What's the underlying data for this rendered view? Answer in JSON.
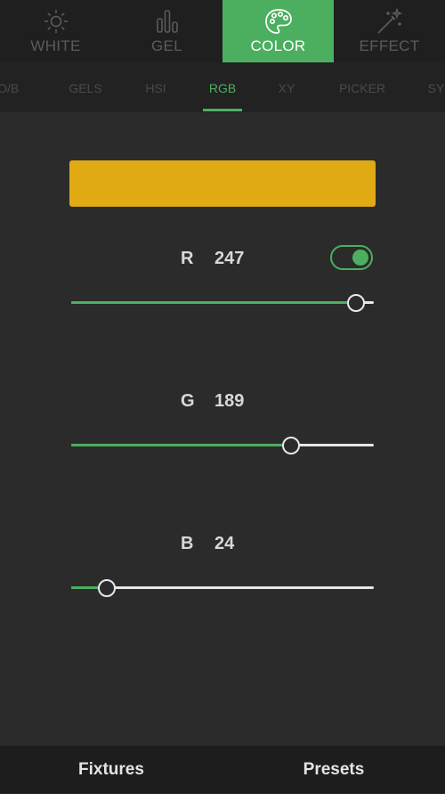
{
  "mode_tabs": [
    {
      "label": "WHITE",
      "icon": "sun-icon"
    },
    {
      "label": "GEL",
      "icon": "bar-chart-icon"
    },
    {
      "label": "COLOR",
      "icon": "palette-icon",
      "active": true
    },
    {
      "label": "EFFECT",
      "icon": "magic-wand-icon"
    }
  ],
  "sub_tabs": [
    "TO/B",
    "GELS",
    "HSI",
    "RGB",
    "XY",
    "PICKER",
    "SY"
  ],
  "active_sub_tab": "RGB",
  "swatch_color": "#dfaa13",
  "channels": [
    {
      "letter": "R",
      "value": "247",
      "level": 247,
      "max": 255
    },
    {
      "letter": "G",
      "value": "189",
      "level": 189,
      "max": 255
    },
    {
      "letter": "B",
      "value": "24",
      "level": 24,
      "max": 255
    }
  ],
  "toggle_on": true,
  "bottom": {
    "fixtures": "Fixtures",
    "presets": "Presets"
  },
  "colors": {
    "accent": "#4caf5f",
    "background": "#2b2b2b"
  }
}
